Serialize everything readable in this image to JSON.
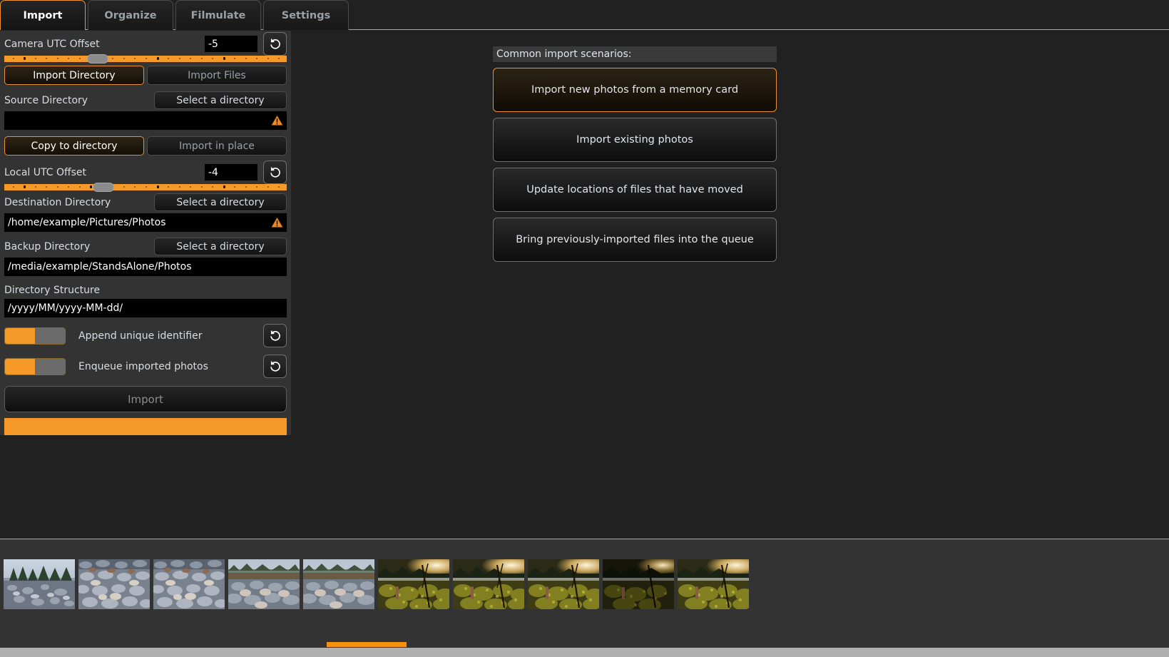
{
  "tabs": [
    {
      "label": "Import",
      "active": true
    },
    {
      "label": "Organize",
      "active": false
    },
    {
      "label": "Filmulate",
      "active": false
    },
    {
      "label": "Settings",
      "active": false
    }
  ],
  "left_panel": {
    "camera_utc": {
      "label": "Camera UTC Offset",
      "value": "-5",
      "reset_icon": "reset-arrow-icon",
      "handle_percent": 33
    },
    "import_mode": {
      "directory_label": "Import Directory",
      "files_label": "Import Files",
      "selected": "directory"
    },
    "source_directory": {
      "label": "Source Directory",
      "button_label": "Select a directory",
      "value": "",
      "warning": true,
      "warning_icon": "warning-triangle-icon"
    },
    "copy_mode": {
      "copy_label": "Copy to directory",
      "inplace_label": "Import in place",
      "selected": "copy"
    },
    "local_utc": {
      "label": "Local UTC Offset",
      "value": "-4",
      "reset_icon": "reset-arrow-icon",
      "handle_percent": 35
    },
    "destination_directory": {
      "label": "Destination Directory",
      "button_label": "Select a directory",
      "value": "/home/example/Pictures/Photos",
      "warning": true,
      "warning_icon": "warning-triangle-icon"
    },
    "backup_directory": {
      "label": "Backup Directory",
      "button_label": "Select a directory",
      "value": "/media/example/StandsAlone/Photos",
      "warning": false
    },
    "directory_structure": {
      "label": "Directory Structure",
      "value": "/yyyy/MM/yyyy-MM-dd/"
    },
    "toggles": [
      {
        "label": "Append unique identifier",
        "on": true,
        "reset_icon": "reset-arrow-icon"
      },
      {
        "label": "Enqueue imported photos",
        "on": true,
        "reset_icon": "reset-arrow-icon"
      }
    ],
    "import_button": {
      "label": "Import",
      "enabled": false
    },
    "progress": {
      "percent": 100
    }
  },
  "scenarios": {
    "header": "Common import scenarios:",
    "items": [
      {
        "label": "Import new photos from a memory card",
        "selected": true
      },
      {
        "label": "Import existing photos",
        "selected": false
      },
      {
        "label": "Update locations of files that have moved",
        "selected": false
      },
      {
        "label": "Bring previously-imported files into the queue",
        "selected": false
      }
    ]
  },
  "filmstrip": {
    "thumbnails": [
      {
        "scene": "rocky-shore-trees",
        "marked": false
      },
      {
        "scene": "cobble-stones",
        "marked": false
      },
      {
        "scene": "cobble-stones",
        "marked": false
      },
      {
        "scene": "shore-horizon-rocks",
        "marked": false
      },
      {
        "scene": "shore-horizon-rocks",
        "marked": true
      },
      {
        "scene": "golden-field-sunset",
        "marked": false
      },
      {
        "scene": "golden-field-sunset",
        "marked": false
      },
      {
        "scene": "golden-field-sunset",
        "marked": false
      },
      {
        "scene": "golden-field-sunset-dark",
        "marked": false
      },
      {
        "scene": "golden-field-sunset",
        "marked": false
      }
    ],
    "scroll_percent": 28
  },
  "colors": {
    "accent": "#f59a28",
    "accent_border": "#e8912d",
    "panel": "#333333",
    "background": "#212121",
    "field": "#000000",
    "text": "#d9dde1",
    "text_dim": "#9aa0a6",
    "marker": "#e8d92a"
  }
}
